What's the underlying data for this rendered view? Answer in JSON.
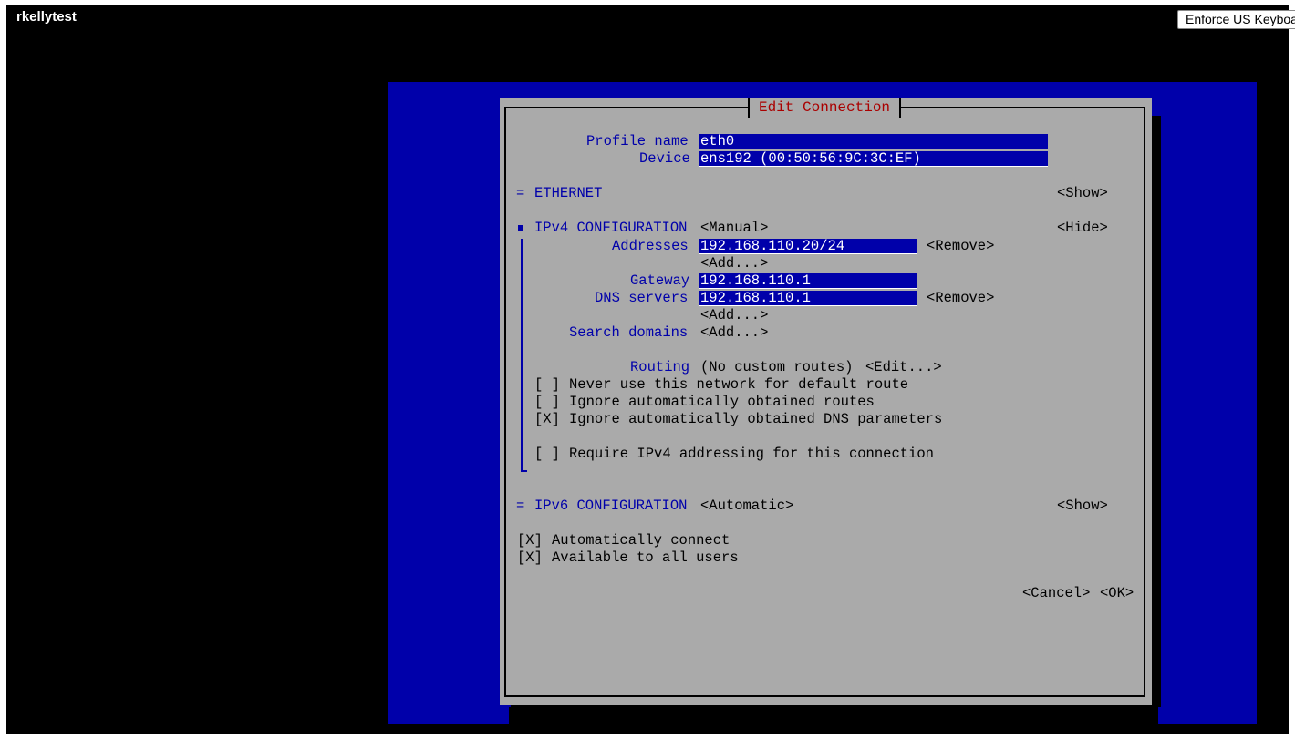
{
  "window": {
    "host_name": "rkellytest",
    "keyboard_button": "Enforce US Keyboard"
  },
  "dialog": {
    "title": "Edit Connection",
    "profile_name_label": "Profile name",
    "profile_name_value": "eth0",
    "device_label": "Device",
    "device_value": "ens192 (00:50:56:9C:3C:EF)",
    "ethernet": {
      "marker": "=",
      "header": "ETHERNET",
      "toggle": "<Show>"
    },
    "ipv4": {
      "header": "IPv4 CONFIGURATION",
      "mode": "<Manual>",
      "toggle": "<Hide>",
      "addresses_label": "Addresses",
      "address_value": "192.168.110.20/24",
      "address_remove": "<Remove>",
      "address_add": "<Add...>",
      "gateway_label": "Gateway",
      "gateway_value": "192.168.110.1",
      "dns_label": "DNS servers",
      "dns_value": "192.168.110.1",
      "dns_remove": "<Remove>",
      "dns_add": "<Add...>",
      "search_label": "Search domains",
      "search_add": "<Add...>",
      "routing_label": "Routing",
      "routing_value": "(No custom routes)",
      "routing_edit": "<Edit...>",
      "never_default": {
        "box": "[ ]",
        "label": "Never use this network for default route"
      },
      "ignore_routes": {
        "box": "[ ]",
        "label": "Ignore automatically obtained routes"
      },
      "ignore_dns": {
        "box": "[X]",
        "label": "Ignore automatically obtained DNS parameters"
      },
      "require_ipv4": {
        "box": "[ ]",
        "label": "Require IPv4 addressing for this connection"
      }
    },
    "ipv6": {
      "marker": "=",
      "header": "IPv6 CONFIGURATION",
      "mode": "<Automatic>",
      "toggle": "<Show>"
    },
    "auto_connect": {
      "box": "[X]",
      "label": "Automatically connect"
    },
    "all_users": {
      "box": "[X]",
      "label": "Available to all users"
    },
    "cancel_button": "<Cancel>",
    "ok_button": "<OK>"
  },
  "colors": {
    "console_background": "#000000",
    "tui_blue": "#0000aa",
    "dialog_gray": "#aaaaaa",
    "title_red": "#aa0000"
  }
}
